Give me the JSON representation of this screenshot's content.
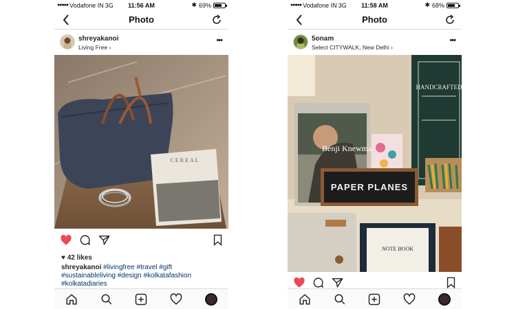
{
  "left": {
    "status": {
      "carrier": "Vodafone IN",
      "network": "3G",
      "time": "11:56 AM",
      "battery_text": "69%",
      "battery_level": 0.69
    },
    "nav": {
      "title": "Photo"
    },
    "post": {
      "username": "shreyakanoi",
      "location": "Living Free ›",
      "likes": "42 likes",
      "caption_user": "shreyakanoi",
      "caption_tags": "#livingfree #travel #gift #sustainableliving #design #kolkatafashion #kolkatadiaries",
      "magazine_title": "CEREAL"
    }
  },
  "right": {
    "status": {
      "carrier": "Vodafone IN",
      "network": "3G",
      "time": "11:58 AM",
      "battery_text": "68%",
      "battery_level": 0.68
    },
    "nav": {
      "title": "Photo"
    },
    "post": {
      "username": "5onam",
      "location": "Select CITYWALK, New Delhi ›",
      "sign_text": "PAPER PLANES",
      "poster_text": "Benji Knewman",
      "notebook_text": "NOTE BOOK",
      "sign_board_text": "HANDCRAFTED"
    }
  },
  "colors": {
    "like_red": "#ed4956",
    "hashtag_blue": "#003569",
    "text": "#262626",
    "divider": "#dbdbdb"
  },
  "icons": [
    "back-chevron-icon",
    "refresh-icon",
    "more-icon",
    "heart-icon",
    "comment-icon",
    "share-icon",
    "bookmark-icon",
    "home-icon",
    "search-icon",
    "add-icon",
    "activity-heart-icon",
    "profile-icon"
  ]
}
